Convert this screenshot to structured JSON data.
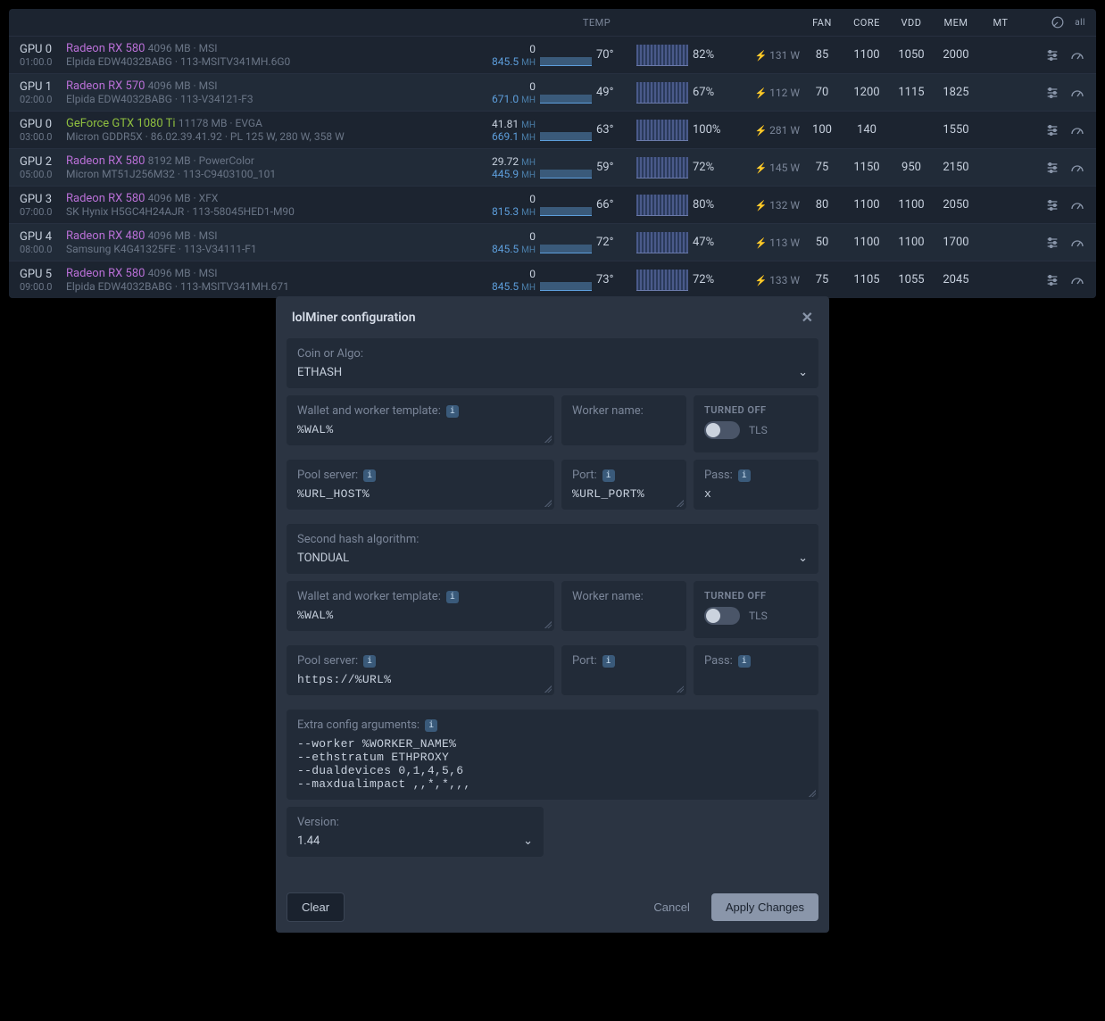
{
  "table": {
    "headers": {
      "temp": "TEMP",
      "fan": "FAN",
      "core": "CORE",
      "vdd": "VDD",
      "mem": "MEM",
      "mt": "MT",
      "all": "all"
    }
  },
  "gpus": [
    {
      "id": "GPU 0",
      "bus": "01:00.0",
      "model": "Radeon RX 580",
      "vendor": "amd",
      "meta": "4096 MB · MSI",
      "detail": "Elpida EDW4032BABG · 113-MSITV341MH.6G0",
      "hash_top": "0",
      "hash_bot": "845.5",
      "hash_unit": "MH",
      "temp": "70°",
      "util": "82%",
      "power": "131 W",
      "fan": "85",
      "core": "1100",
      "vdd": "1050",
      "mem": "2000",
      "mt": ""
    },
    {
      "id": "GPU 1",
      "bus": "02:00.0",
      "model": "Radeon RX 570",
      "vendor": "amd",
      "meta": "4096 MB · MSI",
      "detail": "Elpida EDW4032BABG · 113-V34121-F3",
      "hash_top": "0",
      "hash_bot": "671.0",
      "hash_unit": "MH",
      "temp": "49°",
      "util": "67%",
      "power": "112 W",
      "fan": "70",
      "core": "1200",
      "vdd": "1115",
      "mem": "1825",
      "mt": ""
    },
    {
      "id": "GPU 0",
      "bus": "03:00.0",
      "model": "GeForce GTX 1080 Ti",
      "vendor": "nvidia",
      "meta": "11178 MB · EVGA",
      "detail": "Micron GDDR5X · 86.02.39.41.92 · PL 125 W, 280 W, 358 W",
      "hash_top": "41.81",
      "hash_bot": "669.1",
      "hash_unit": "MH",
      "temp": "63°",
      "util": "100%",
      "power": "281 W",
      "fan": "100",
      "core": "140",
      "vdd": "",
      "mem": "1550",
      "mt": ""
    },
    {
      "id": "GPU 2",
      "bus": "05:00.0",
      "model": "Radeon RX 580",
      "vendor": "amd",
      "meta": "8192 MB · PowerColor",
      "detail": "Micron MT51J256M32 · 113-C9403100_101",
      "hash_top": "29.72",
      "hash_bot": "445.9",
      "hash_unit": "MH",
      "temp": "59°",
      "util": "72%",
      "power": "145 W",
      "fan": "75",
      "core": "1150",
      "vdd": "950",
      "mem": "2150",
      "mt": ""
    },
    {
      "id": "GPU 3",
      "bus": "07:00.0",
      "model": "Radeon RX 580",
      "vendor": "amd",
      "meta": "4096 MB · XFX",
      "detail": "SK Hynix H5GC4H24AJR · 113-58045HED1-M90",
      "hash_top": "0",
      "hash_bot": "815.3",
      "hash_unit": "MH",
      "temp": "66°",
      "util": "80%",
      "power": "132 W",
      "fan": "80",
      "core": "1100",
      "vdd": "1100",
      "mem": "2050",
      "mt": ""
    },
    {
      "id": "GPU 4",
      "bus": "08:00.0",
      "model": "Radeon RX 480",
      "vendor": "amd",
      "meta": "4096 MB · MSI",
      "detail": "Samsung K4G41325FE · 113-V34111-F1",
      "hash_top": "0",
      "hash_bot": "845.5",
      "hash_unit": "MH",
      "temp": "72°",
      "util": "47%",
      "power": "113 W",
      "fan": "50",
      "core": "1100",
      "vdd": "1100",
      "mem": "1700",
      "mt": ""
    },
    {
      "id": "GPU 5",
      "bus": "09:00.0",
      "model": "Radeon RX 580",
      "vendor": "amd",
      "meta": "4096 MB · MSI",
      "detail": "Elpida EDW4032BABG · 113-MSITV341MH.671",
      "hash_top": "0",
      "hash_bot": "845.5",
      "hash_unit": "MH",
      "temp": "73°",
      "util": "72%",
      "power": "133 W",
      "fan": "75",
      "core": "1105",
      "vdd": "1055",
      "mem": "2045",
      "mt": ""
    }
  ],
  "modal": {
    "title": "lolMiner configuration",
    "coin_label": "Coin or Algo:",
    "coin_value": "ETHASH",
    "wallet_label": "Wallet and worker template:",
    "wallet1_value": "%WAL%",
    "worker_label": "Worker name:",
    "worker1_value": "",
    "tls_status": "TURNED OFF",
    "tls_label": "TLS",
    "pool_label": "Pool server:",
    "pool1_value": "%URL_HOST%",
    "port_label": "Port:",
    "port1_value": "%URL_PORT%",
    "pass_label": "Pass:",
    "pass1_value": "x",
    "second_algo_label": "Second hash algorithm:",
    "second_algo_value": "TONDUAL",
    "wallet2_value": "%WAL%",
    "worker2_value": "",
    "pool2_value": "https://%URL%",
    "port2_value": "",
    "pass2_value": "",
    "extra_label": "Extra config arguments:",
    "extra_value": "--worker %WORKER_NAME%\n--ethstratum ETHPROXY\n--dualdevices 0,1,4,5,6\n--maxdualimpact ,,*,*,,,",
    "version_label": "Version:",
    "version_value": "1.44",
    "clear": "Clear",
    "cancel": "Cancel",
    "apply": "Apply Changes"
  }
}
